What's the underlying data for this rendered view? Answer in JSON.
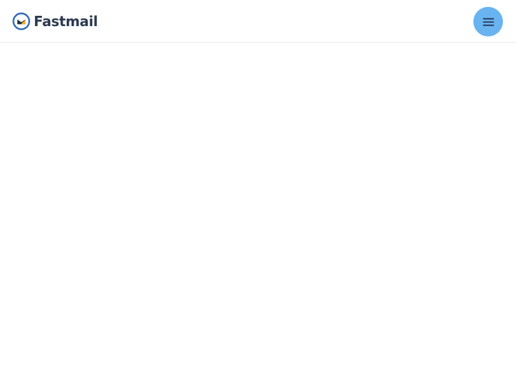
{
  "header": {
    "brand_name": "Fastmail",
    "logo_icon": "fastmail-logo-icon",
    "menu_icon": "hamburger-menu-icon"
  },
  "colors": {
    "brand_text": "#2d3a4f",
    "menu_button_bg": "#69b3f0",
    "logo_ring": "#2f69b3",
    "logo_accent": "#f6b21a"
  }
}
